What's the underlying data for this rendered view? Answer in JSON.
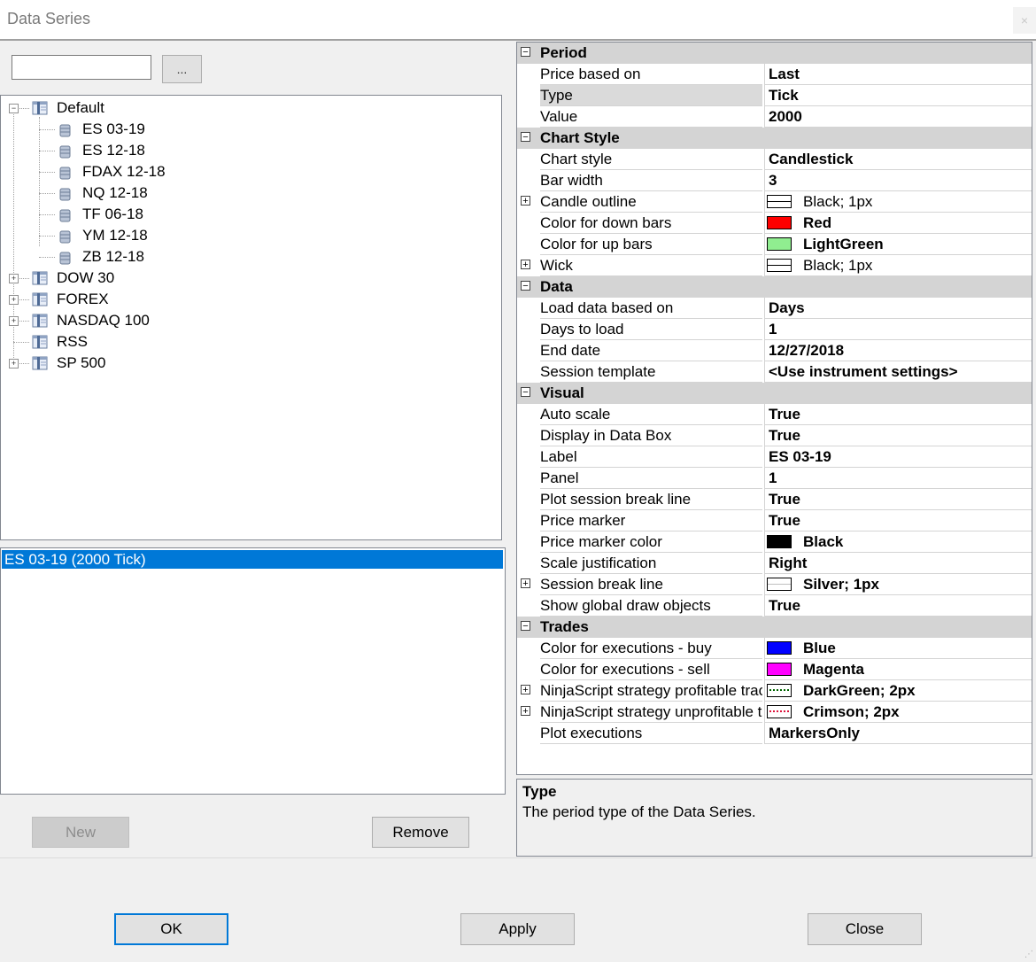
{
  "window": {
    "title": "Data Series",
    "close_glyph": "×"
  },
  "search": {
    "value": "",
    "browse_label": "..."
  },
  "tree": [
    {
      "label": "Default",
      "kind": "folder",
      "expander": "−"
    },
    {
      "label": "ES 03-19",
      "kind": "instrument"
    },
    {
      "label": "ES 12-18",
      "kind": "instrument"
    },
    {
      "label": "FDAX 12-18",
      "kind": "instrument"
    },
    {
      "label": "NQ 12-18",
      "kind": "instrument"
    },
    {
      "label": "TF 06-18",
      "kind": "instrument"
    },
    {
      "label": "YM 12-18",
      "kind": "instrument"
    },
    {
      "label": "ZB 12-18",
      "kind": "instrument"
    },
    {
      "label": "DOW 30",
      "kind": "folder",
      "expander": "+"
    },
    {
      "label": "FOREX",
      "kind": "folder",
      "expander": "+"
    },
    {
      "label": "NASDAQ 100",
      "kind": "folder",
      "expander": "+"
    },
    {
      "label": "RSS",
      "kind": "folder",
      "expander": ""
    },
    {
      "label": "SP 500",
      "kind": "folder",
      "expander": "+"
    }
  ],
  "series_list": {
    "selected_item": "ES 03-19 (2000 Tick)"
  },
  "buttons": {
    "new": "New",
    "remove": "Remove",
    "ok": "OK",
    "apply": "Apply",
    "close": "Close"
  },
  "properties": {
    "rows": [
      {
        "type": "category",
        "name": "Period",
        "glyph": "−"
      },
      {
        "name": "Price based on",
        "value": "Last"
      },
      {
        "name": "Type",
        "value": "Tick",
        "selected": true
      },
      {
        "name": "Value",
        "value": "2000"
      },
      {
        "type": "category",
        "name": "Chart Style",
        "glyph": "−"
      },
      {
        "name": "Chart style",
        "value": "Candlestick"
      },
      {
        "name": "Bar width",
        "value": "3"
      },
      {
        "name": "Candle outline",
        "value": "Black; 1px",
        "swatch": "stroke",
        "stroke_color": "#000000",
        "expand": "+",
        "light": true
      },
      {
        "name": "Color for down bars",
        "value": "Red",
        "swatch": "fill",
        "color": "#ff0000"
      },
      {
        "name": "Color for up bars",
        "value": "LightGreen",
        "swatch": "fill",
        "color": "#90ee90"
      },
      {
        "name": "Wick",
        "value": "Black; 1px",
        "swatch": "stroke",
        "stroke_color": "#000000",
        "expand": "+",
        "light": true
      },
      {
        "type": "category",
        "name": "Data",
        "glyph": "−"
      },
      {
        "name": "Load data based on",
        "value": "Days"
      },
      {
        "name": "Days to load",
        "value": "1"
      },
      {
        "name": "End date",
        "value": "12/27/2018"
      },
      {
        "name": "Session template",
        "value": "<Use instrument settings>"
      },
      {
        "type": "category",
        "name": "Visual",
        "glyph": "−"
      },
      {
        "name": "Auto scale",
        "value": "True"
      },
      {
        "name": "Display in Data Box",
        "value": "True"
      },
      {
        "name": "Label",
        "value": "ES 03-19"
      },
      {
        "name": "Panel",
        "value": "1"
      },
      {
        "name": "Plot session break line",
        "value": "True"
      },
      {
        "name": "Price marker",
        "value": "True"
      },
      {
        "name": "Price marker color",
        "value": "Black",
        "swatch": "fill",
        "color": "#000000"
      },
      {
        "name": "Scale justification",
        "value": "Right"
      },
      {
        "name": "Session break line",
        "value": "Silver; 1px",
        "swatch": "stroke",
        "stroke_color": "#c0c0c0",
        "expand": "+"
      },
      {
        "name": "Show global draw objects",
        "value": "True"
      },
      {
        "type": "category",
        "name": "Trades",
        "glyph": "−"
      },
      {
        "name": "Color for executions - buy",
        "value": "Blue",
        "swatch": "fill",
        "color": "#0000ff"
      },
      {
        "name": "Color for executions - sell",
        "value": "Magenta",
        "swatch": "fill",
        "color": "#ff00ff"
      },
      {
        "name": "NinjaScript strategy profitable trac",
        "value": "DarkGreen; 2px",
        "swatch": "dotted",
        "stroke_color": "#006400",
        "expand": "+"
      },
      {
        "name": "NinjaScript strategy unprofitable tr",
        "value": "Crimson; 2px",
        "swatch": "dotted",
        "stroke_color": "#dc143c",
        "expand": "+"
      },
      {
        "name": "Plot executions",
        "value": "MarkersOnly"
      }
    ]
  },
  "description": {
    "title": "Type",
    "text": "The period type of the Data Series."
  },
  "colors": {
    "selection": "#0078d7",
    "category_bg": "#d4d4d4",
    "window_bg": "#f0f0f0"
  }
}
